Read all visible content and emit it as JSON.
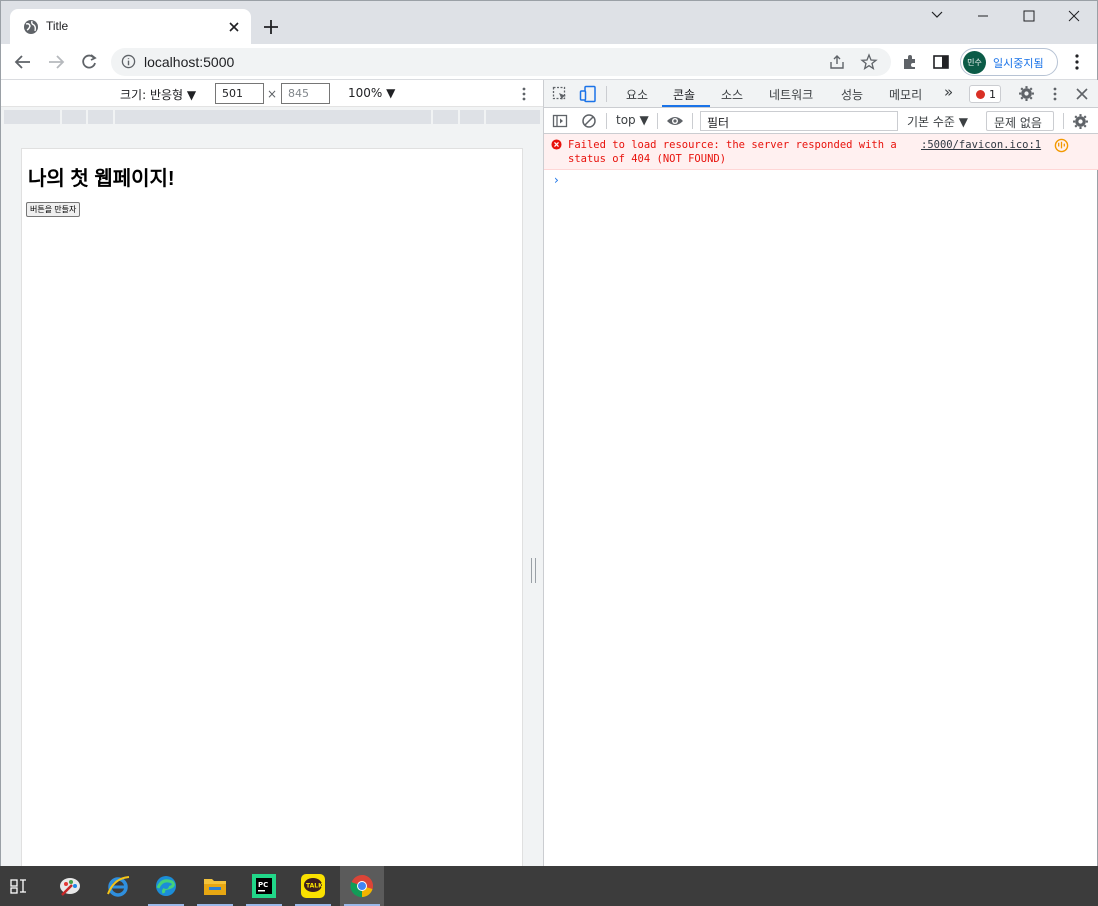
{
  "browser": {
    "tab_title": "Title",
    "url": "localhost:5000",
    "profile_initials": "민수",
    "profile_label": "일시중지됨"
  },
  "device_toolbar": {
    "size_label": "크기: 반응형 ▼",
    "width": "501",
    "times": "×",
    "height_placeholder": "845",
    "zoom": "100% ▼"
  },
  "page": {
    "heading": "나의 첫 웹페이지!",
    "button_label": "버튼을 만들자"
  },
  "devtools": {
    "tabs": [
      "요소",
      "콘솔",
      "소스",
      "네트워크",
      "성능",
      "메모리"
    ],
    "more": "»",
    "error_count": "1",
    "context": "top ▼",
    "filter_placeholder": "필터",
    "level": "기본 수준 ▼",
    "issues": "문제 없음",
    "error_message": "Failed to load resource: the server responded with a\nstatus of 404 (NOT FOUND)",
    "error_source": ":5000/favicon.ico:1",
    "prompt": "›"
  },
  "colors": {
    "accent": "#1a73e8",
    "error": "#e8120c",
    "tabstrip": "#dee1e6"
  }
}
